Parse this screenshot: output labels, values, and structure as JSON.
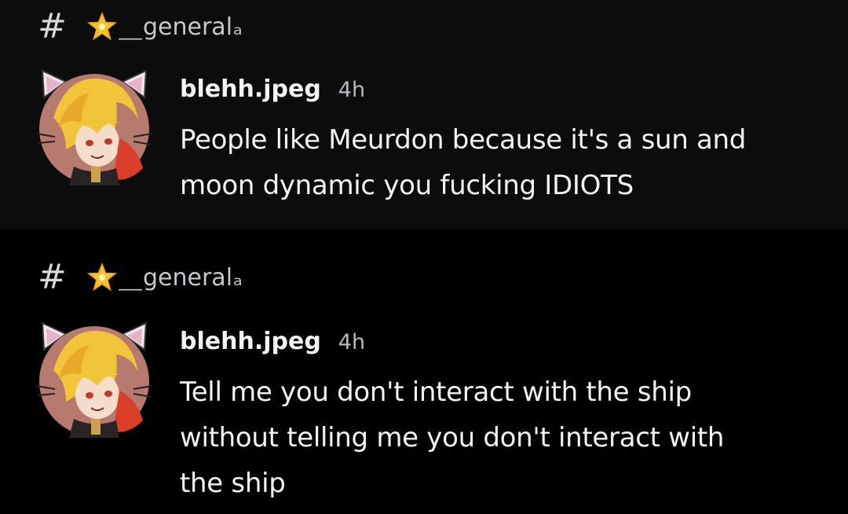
{
  "messages": [
    {
      "channel": {
        "hash": "#",
        "prefix": "⸏",
        "name": "general",
        "suffix": "ₐ"
      },
      "author": "blehh.jpeg",
      "time": "4h",
      "lines": [
        "People like Meurdon because it's a sun and",
        "moon dynamic you fucking IDIOTS"
      ]
    },
    {
      "channel": {
        "hash": "#",
        "prefix": "⸏",
        "name": "general",
        "suffix": "ₐ"
      },
      "author": "blehh.jpeg",
      "time": "4h",
      "lines": [
        "Tell me you don't interact with the ship",
        "without telling me you don't interact with",
        "the ship"
      ]
    }
  ],
  "colors": {
    "block_1_bg": "#0c0c0d",
    "block_2_bg": "#000000",
    "text": "#f2f3f5",
    "muted": "#b5bac1",
    "star": "#f7c32e"
  },
  "icons": {
    "channel": "hash-icon",
    "emoji": "glowing-star-icon",
    "avatar": "user-avatar"
  }
}
